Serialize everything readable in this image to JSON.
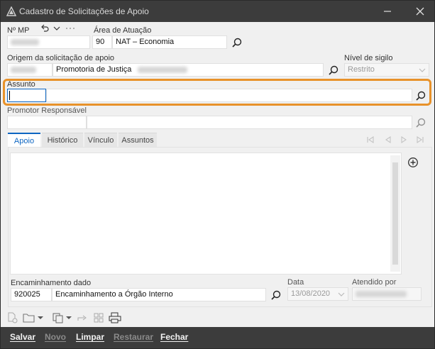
{
  "window": {
    "title": "Cadastro de Solicitações de Apoio",
    "app_icon": "app-logo-icon",
    "controls": [
      "minimize-icon",
      "close-icon"
    ]
  },
  "header": {
    "mp_label": "Nº MP",
    "mp_value": "",
    "area_label": "Área de Atuação",
    "area_code": "90",
    "area_name": "NAT – Economia"
  },
  "origem": {
    "label": "Origem da solicitação de apoio",
    "code": "",
    "name": "Promotoria de Justiça"
  },
  "sigilo": {
    "label": "Nível de sigilo",
    "value": "Restrito"
  },
  "assunto": {
    "label": "Assunto",
    "code": "",
    "name": ""
  },
  "promotor": {
    "label": "Promotor Responsável",
    "code": "",
    "name": ""
  },
  "tabs": [
    {
      "label": "Apoio",
      "active": true
    },
    {
      "label": "Histórico",
      "active": false
    },
    {
      "label": "Vínculo",
      "active": false
    },
    {
      "label": "Assuntos",
      "active": false
    }
  ],
  "apoio": {
    "text": "",
    "encaminhamento_label": "Encaminhamento dado",
    "encaminhamento_code": "920025",
    "encaminhamento_name": "Encaminhamento a Órgão Interno",
    "data_label": "Data",
    "data_value": "13/08/2020",
    "atendido_label": "Atendido por",
    "atendido_value": ""
  },
  "footer": {
    "salvar": "Salvar",
    "novo": "Novo",
    "limpar": "Limpar",
    "restaurar": "Restaurar",
    "fechar": "Fechar"
  },
  "colors": {
    "accent": "#0e66c2",
    "highlight": "#e8922a",
    "titlebar": "#3c3c3c"
  }
}
